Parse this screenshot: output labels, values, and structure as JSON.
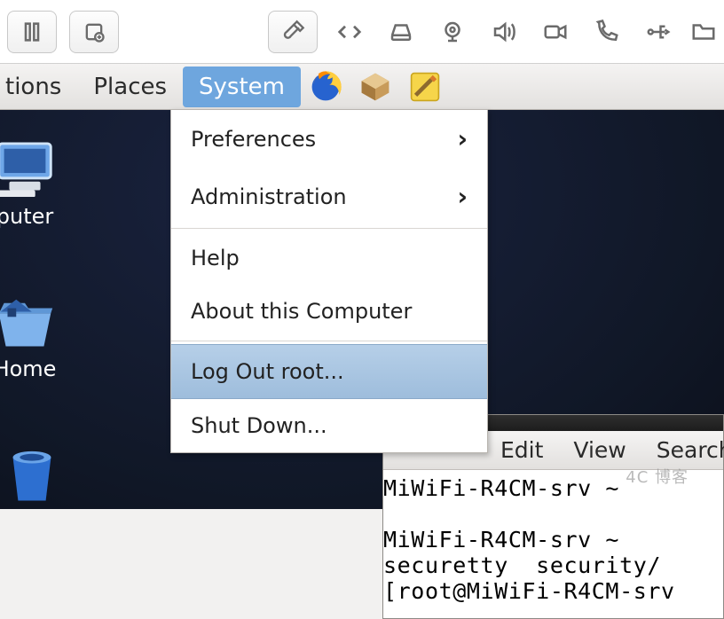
{
  "vm_toolbar": {
    "icons": [
      "pause",
      "snapshot",
      "wrench",
      "code",
      "disk",
      "camera",
      "volume",
      "video",
      "phone",
      "usb",
      "folder"
    ]
  },
  "menubar": {
    "items_left_clipped": "tions",
    "places": "Places",
    "system": "System"
  },
  "dropdown": {
    "preferences": "Preferences",
    "administration": "Administration",
    "help": "Help",
    "about": "About this Computer",
    "logout": "Log Out root...",
    "shutdown": "Shut Down..."
  },
  "desktop": {
    "computer": "puter",
    "home": "Home"
  },
  "terminal": {
    "menu": {
      "edit": "Edit",
      "view": "View",
      "search": "Search"
    },
    "line1": "MiWiFi-R4CM-srv ~",
    "line2": "",
    "line3": "MiWiFi-R4CM-srv ~",
    "line4": "securetty  security/",
    "line5": "[root@MiWiFi-R4CM-srv"
  },
  "watermark": "4C 博客"
}
